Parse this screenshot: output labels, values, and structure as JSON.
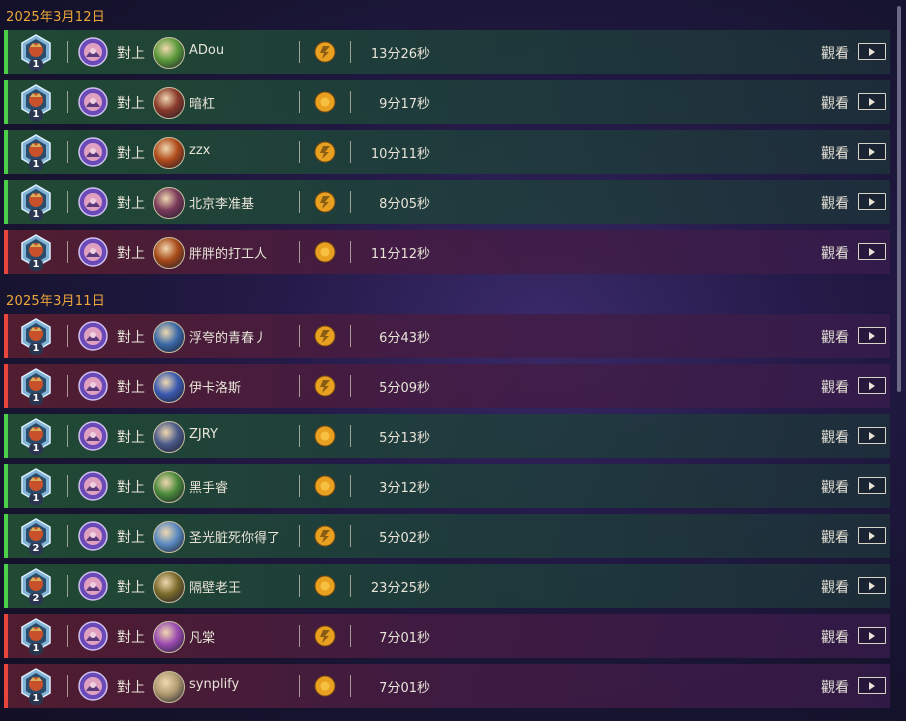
{
  "groups": [
    {
      "date": "2025年3月12日",
      "rows": [
        {
          "result": "win",
          "rank": "1",
          "vs": "對上",
          "opponent": "ADou",
          "avatar_color": "#5a9a3a",
          "coin": "used",
          "duration": "13分26秒",
          "watch": "觀看"
        },
        {
          "result": "win",
          "rank": "1",
          "vs": "對上",
          "opponent": "暗杠",
          "avatar_color": "#8a3a2a",
          "coin": "none",
          "duration": "9分17秒",
          "watch": "觀看"
        },
        {
          "result": "win",
          "rank": "1",
          "vs": "對上",
          "opponent": "zzx",
          "avatar_color": "#b04a1a",
          "coin": "used",
          "duration": "10分11秒",
          "watch": "觀看"
        },
        {
          "result": "win",
          "rank": "1",
          "vs": "對上",
          "opponent": "北京李准基",
          "avatar_color": "#7a3a5a",
          "coin": "used",
          "duration": "8分05秒",
          "watch": "觀看"
        },
        {
          "result": "loss",
          "rank": "1",
          "vs": "對上",
          "opponent": "胖胖的打工人",
          "avatar_color": "#a84a18",
          "coin": "none",
          "duration": "11分12秒",
          "watch": "觀看"
        }
      ]
    },
    {
      "date": "2025年3月11日",
      "rows": [
        {
          "result": "loss",
          "rank": "1",
          "vs": "對上",
          "opponent": "浮夸的青春丿",
          "avatar_color": "#3a6aa8",
          "coin": "used",
          "duration": "6分43秒",
          "watch": "觀看"
        },
        {
          "result": "loss",
          "rank": "1",
          "vs": "對上",
          "opponent": "伊卡洛斯",
          "avatar_color": "#3a5ab0",
          "coin": "used",
          "duration": "5分09秒",
          "watch": "觀看"
        },
        {
          "result": "win",
          "rank": "1",
          "vs": "對上",
          "opponent": "ZJRY",
          "avatar_color": "#4a5a8a",
          "coin": "none",
          "duration": "5分13秒",
          "watch": "觀看"
        },
        {
          "result": "win",
          "rank": "1",
          "vs": "對上",
          "opponent": "黑手睿",
          "avatar_color": "#4a8a3a",
          "coin": "none",
          "duration": "3分12秒",
          "watch": "觀看"
        },
        {
          "result": "win",
          "rank": "2",
          "vs": "對上",
          "opponent": "圣光脏死你得了",
          "avatar_color": "#5a8ac0",
          "coin": "used",
          "duration": "5分02秒",
          "watch": "觀看"
        },
        {
          "result": "win",
          "rank": "2",
          "vs": "對上",
          "opponent": "隔壁老王",
          "avatar_color": "#7a6a2a",
          "coin": "none",
          "duration": "23分25秒",
          "watch": "觀看"
        },
        {
          "result": "loss",
          "rank": "1",
          "vs": "對上",
          "opponent": "凡棠",
          "avatar_color": "#9a4ab0",
          "coin": "used",
          "duration": "7分01秒",
          "watch": "觀看"
        },
        {
          "result": "loss",
          "rank": "1",
          "vs": "對上",
          "opponent": "synplify",
          "avatar_color": "#b09a70",
          "coin": "none",
          "duration": "7分01秒",
          "watch": "觀看"
        }
      ]
    }
  ],
  "colors": {
    "win_accent": "#4ccf4a",
    "loss_accent": "#e8463c",
    "date_color": "#f0a83a",
    "coin_color": "#e8a020"
  },
  "icons": {
    "rank_badge": "rank-badge-icon",
    "hero": "hero-portrait-icon",
    "coin": "coin-icon",
    "play": "play-icon"
  }
}
